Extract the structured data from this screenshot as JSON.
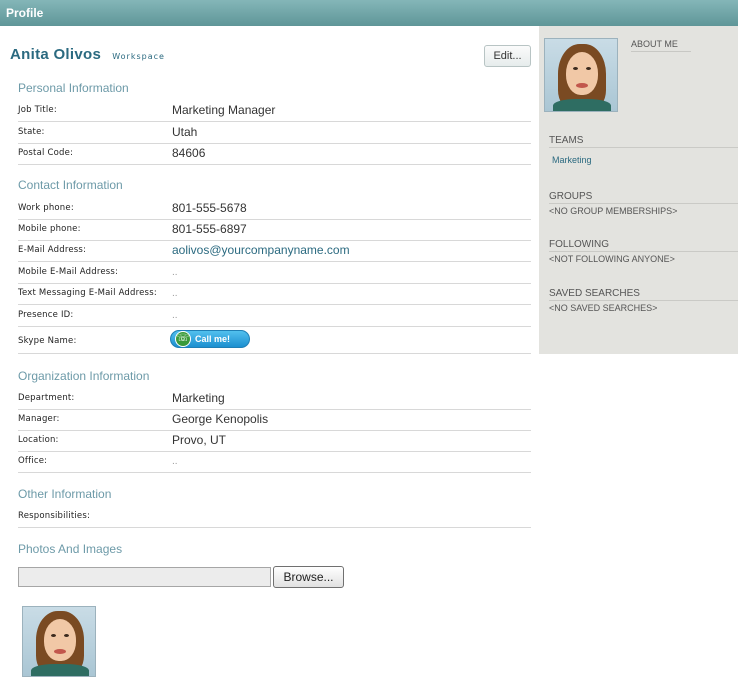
{
  "window": {
    "title": "Profile"
  },
  "profile": {
    "name": "Anita Olivos",
    "workspace_link": "Workspace",
    "edit_label": "Edit..."
  },
  "sections": {
    "personal": {
      "heading": "Personal Information",
      "fields": [
        {
          "label": "Job Title:",
          "value": "Marketing Manager"
        },
        {
          "label": "State:",
          "value": "Utah"
        },
        {
          "label": "Postal Code:",
          "value": "84606"
        }
      ]
    },
    "contact": {
      "heading": "Contact Information",
      "fields": [
        {
          "label": "Work phone:",
          "value": "801-555-5678"
        },
        {
          "label": "Mobile phone:",
          "value": "801-555-6897"
        },
        {
          "label": "E-Mail Address:",
          "value": "aolivos@yourcompanyname.com"
        },
        {
          "label": "Mobile E-Mail Address:",
          "value": ".."
        },
        {
          "label": "Text Messaging E-Mail Address:",
          "value": ".."
        },
        {
          "label": "Presence ID:",
          "value": ".."
        },
        {
          "label": "Skype Name:",
          "value": "Call me!"
        }
      ]
    },
    "organization": {
      "heading": "Organization Information",
      "fields": [
        {
          "label": "Department:",
          "value": "Marketing"
        },
        {
          "label": "Manager:",
          "value": "George Kenopolis"
        },
        {
          "label": "Location:",
          "value": "Provo, UT"
        },
        {
          "label": "Office:",
          "value": ".."
        }
      ]
    },
    "other": {
      "heading": "Other Information",
      "fields": [
        {
          "label": "Responsibilities:",
          "value": ""
        }
      ]
    },
    "photos": {
      "heading": "Photos And Images",
      "browse_label": "Browse..."
    }
  },
  "sidebar": {
    "about_me": "ABOUT ME",
    "teams": {
      "heading": "TEAMS",
      "items": [
        "Marketing"
      ]
    },
    "groups": {
      "heading": "GROUPS",
      "value": "<NO GROUP MEMBERSHIPS>"
    },
    "following": {
      "heading": "FOLLOWING",
      "value": "<NOT FOLLOWING ANYONE>"
    },
    "saved_searches": {
      "heading": "SAVED SEARCHES",
      "value": "<NO SAVED SEARCHES>"
    }
  },
  "icons": {
    "skype": "skype-phone-icon"
  },
  "colors": {
    "titlebar": "#6fa7a9",
    "heading": "#6d9aa8",
    "link": "#2b6a80",
    "sidebar_bg": "#e3e3df",
    "skype_button": "#29a3e0"
  }
}
